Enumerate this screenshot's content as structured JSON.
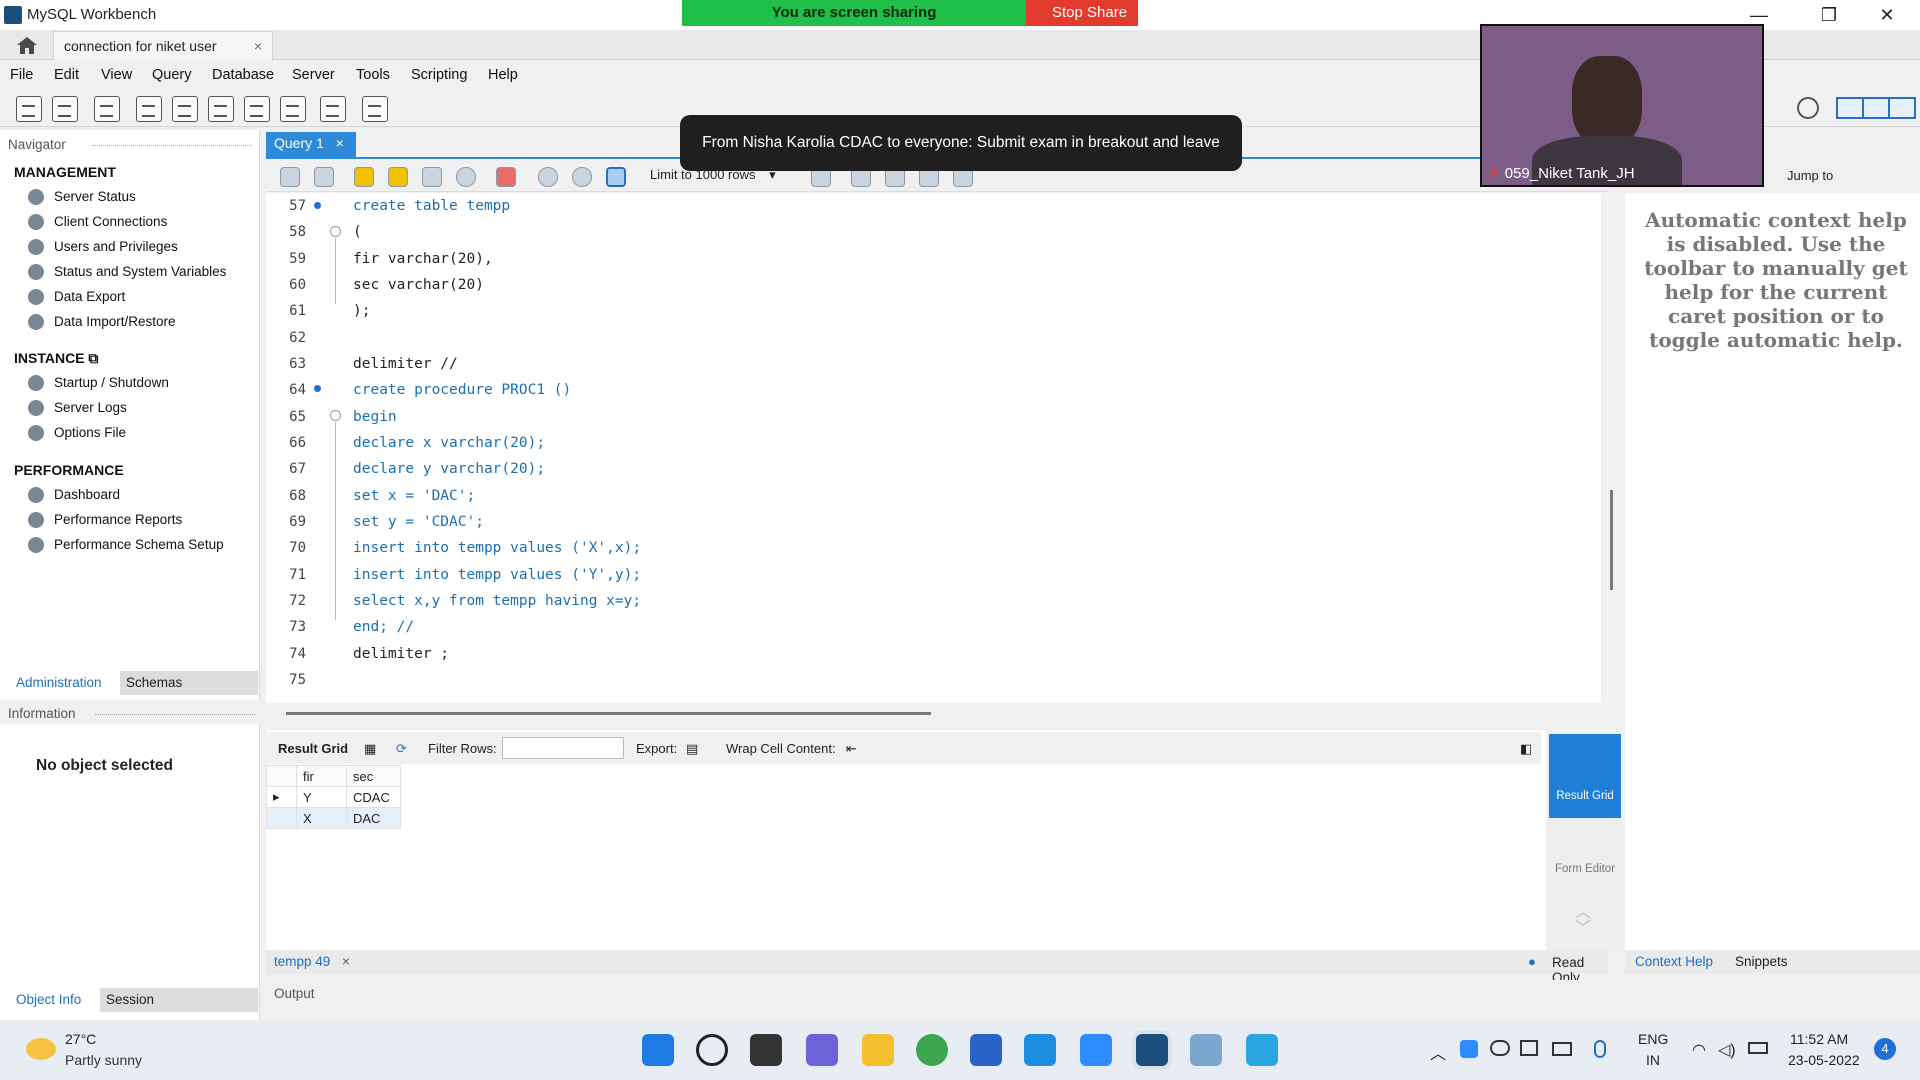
{
  "window": {
    "title": "MySQL Workbench",
    "minimize": "—",
    "restore": "❐",
    "close": "✕"
  },
  "connection_tab": {
    "label": "connection for niket user",
    "close": "×"
  },
  "menu": [
    "File",
    "Edit",
    "View",
    "Query",
    "Database",
    "Server",
    "Tools",
    "Scripting",
    "Help"
  ],
  "navigator": {
    "header": "Navigator",
    "management": {
      "title": "MANAGEMENT",
      "items": [
        "Server Status",
        "Client Connections",
        "Users and Privileges",
        "Status and System Variables",
        "Data Export",
        "Data Import/Restore"
      ]
    },
    "instance": {
      "title": "INSTANCE",
      "items": [
        "Startup / Shutdown",
        "Server Logs",
        "Options File"
      ]
    },
    "performance": {
      "title": "PERFORMANCE",
      "items": [
        "Dashboard",
        "Performance Reports",
        "Performance Schema Setup"
      ]
    },
    "tabs": [
      "Administration",
      "Schemas"
    ]
  },
  "information": {
    "header": "Information",
    "empty": "No object selected",
    "tabs": [
      "Object Info",
      "Session"
    ]
  },
  "query_tab": {
    "label": "Query 1",
    "close": "×"
  },
  "editor_toolbar": {
    "limit": "Limit to 1000 rows",
    "jump_to": "Jump to"
  },
  "code_lines": [
    {
      "n": "57",
      "t": "create table tempp"
    },
    {
      "n": "58",
      "t": "("
    },
    {
      "n": "59",
      "t": "fir varchar(20),"
    },
    {
      "n": "60",
      "t": "sec varchar(20)"
    },
    {
      "n": "61",
      "t": ");"
    },
    {
      "n": "62",
      "t": ""
    },
    {
      "n": "63",
      "t": "delimiter //"
    },
    {
      "n": "64",
      "t": "create procedure PROC1 ()"
    },
    {
      "n": "65",
      "t": "begin"
    },
    {
      "n": "66",
      "t": "declare x varchar(20);"
    },
    {
      "n": "67",
      "t": "declare y varchar(20);"
    },
    {
      "n": "68",
      "t": "set x = 'DAC';"
    },
    {
      "n": "69",
      "t": "set y = 'CDAC';"
    },
    {
      "n": "70",
      "t": "insert into tempp values ('X',x);"
    },
    {
      "n": "71",
      "t": "insert into tempp values ('Y',y);"
    },
    {
      "n": "72",
      "t": "select x,y from tempp having x=y;"
    },
    {
      "n": "73",
      "t": "end; //"
    },
    {
      "n": "74",
      "t": "delimiter ;"
    },
    {
      "n": "75",
      "t": ""
    }
  ],
  "result_toolbar": {
    "result_grid": "Result Grid",
    "filter_rows": "Filter Rows:",
    "export": "Export:",
    "wrap": "Wrap Cell Content:"
  },
  "result_grid": {
    "columns": [
      "fir",
      "sec"
    ],
    "rows": [
      [
        "Y",
        "CDAC"
      ],
      [
        "X",
        "DAC"
      ]
    ]
  },
  "side_buttons": {
    "result_grid": "Result Grid",
    "form_editor": "Form Editor"
  },
  "bottom": {
    "result_tab": "tempp 49",
    "read_only": "Read Only",
    "output": "Output"
  },
  "right_panel": {
    "help": "Automatic context help is disabled. Use the toolbar to manually get help for the current caret position or to toggle automatic help.",
    "tabs": [
      "Context Help",
      "Snippets"
    ]
  },
  "zoom": {
    "sharing": "You are screen sharing",
    "stop": "Stop Share",
    "chat": "From Nisha Karolia CDAC to everyone: Submit exam in breakout and leave",
    "participant": "059_Niket Tank_JH"
  },
  "taskbar": {
    "temp": "27°C",
    "weather": "Partly sunny",
    "lang1": "ENG",
    "lang2": "IN",
    "time": "11:52 AM",
    "date": "23-05-2022",
    "notif": "4"
  }
}
